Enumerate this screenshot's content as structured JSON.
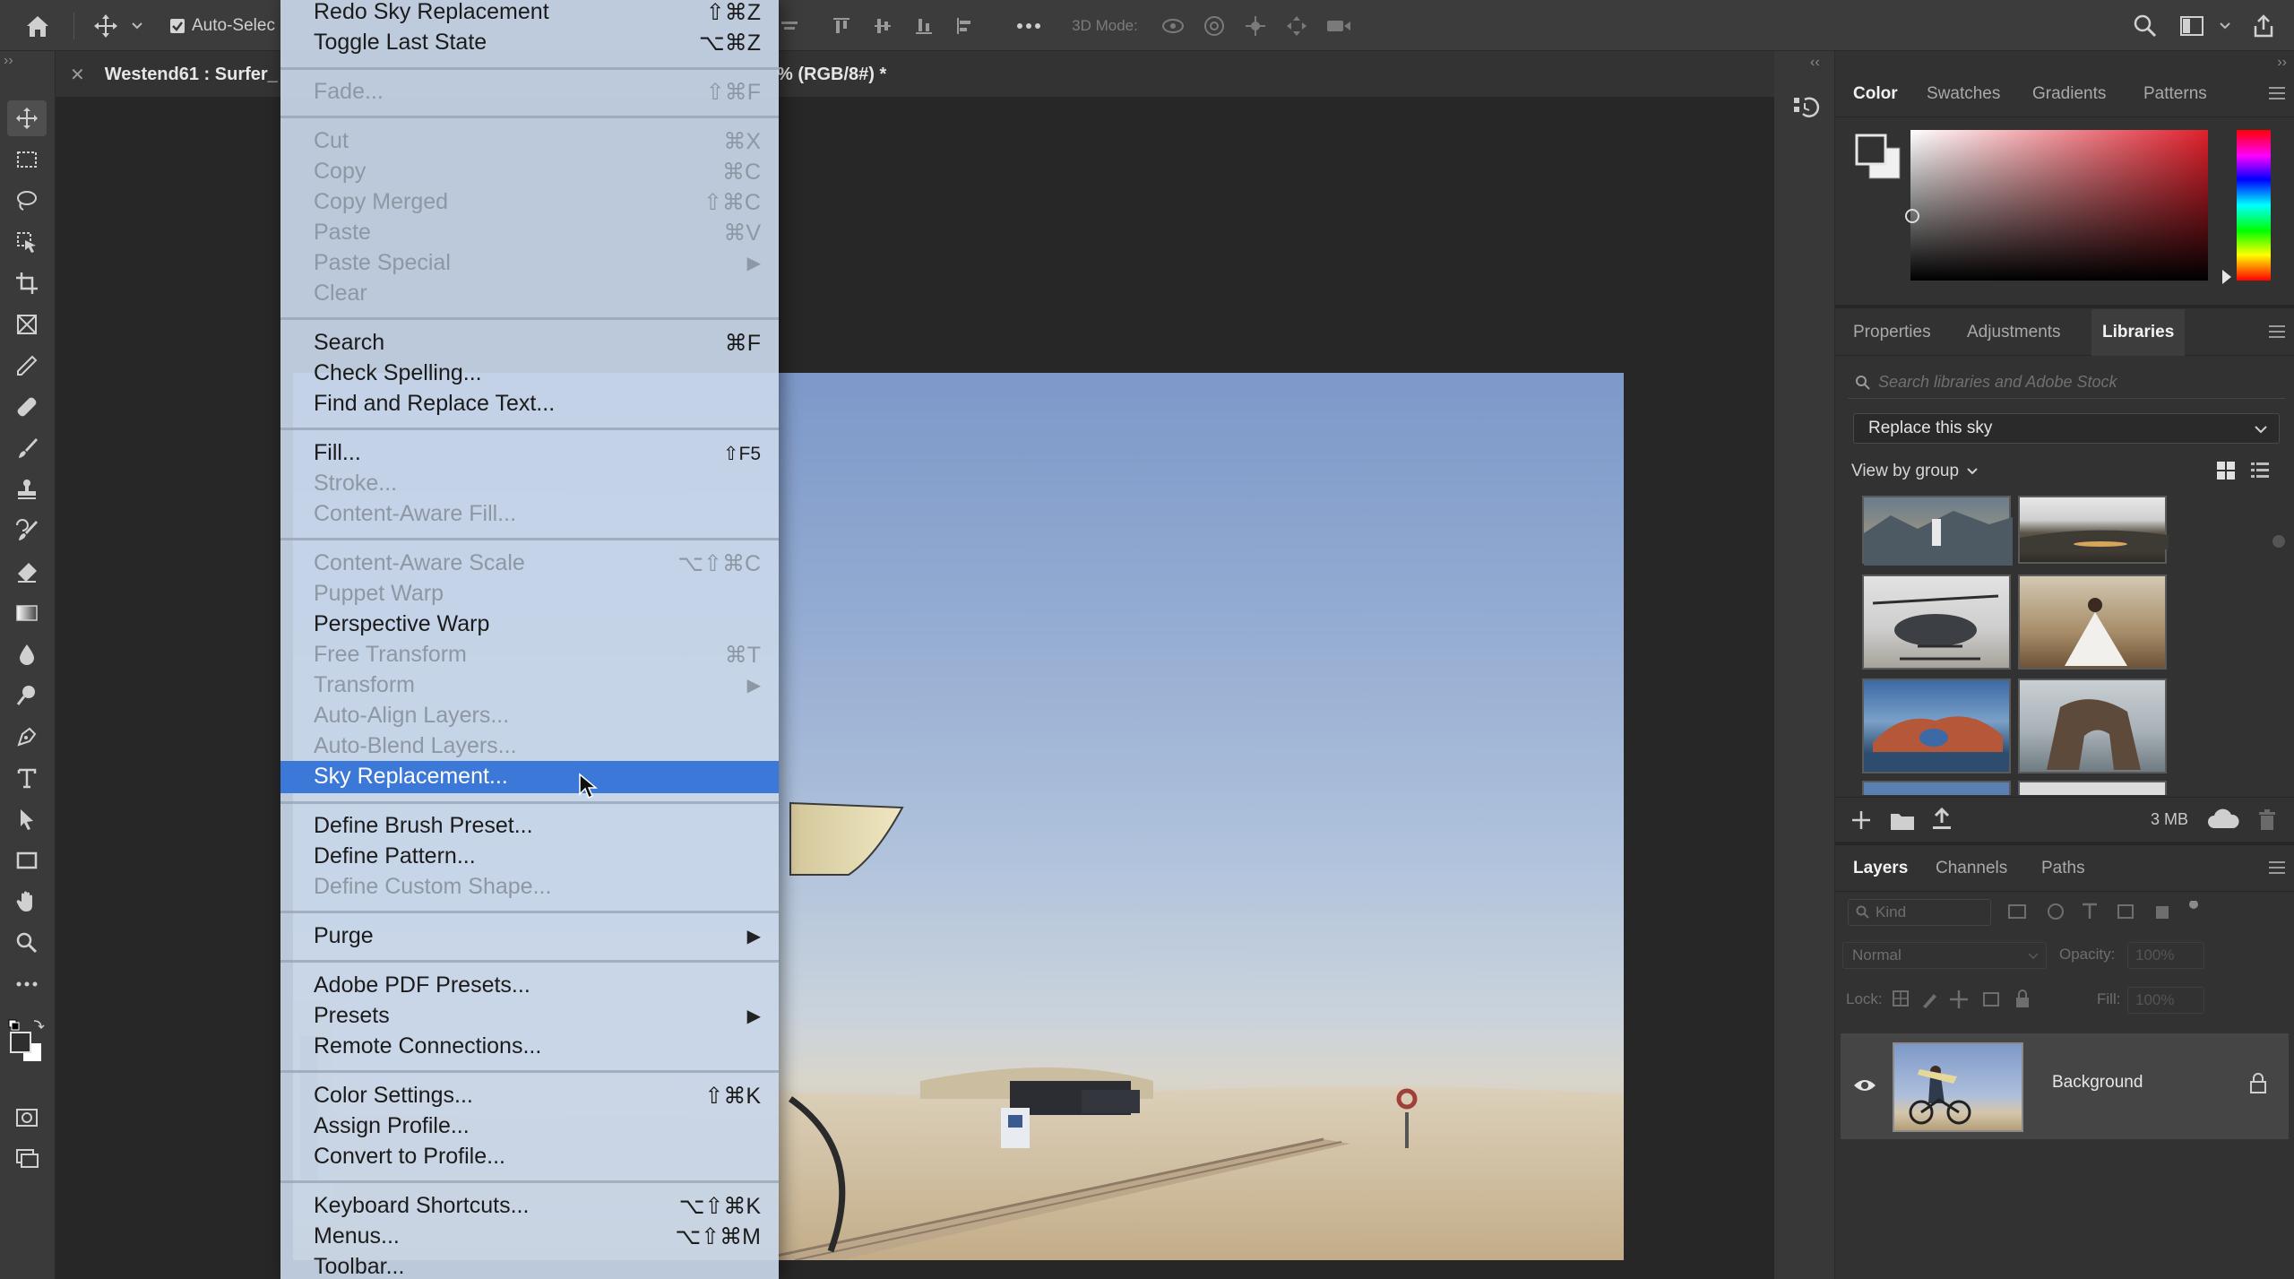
{
  "app": {
    "options_bar": {
      "auto_select_label": "Auto-Selec",
      "mode_3d_label": "3D Mode:"
    },
    "document_tab": {
      "title": "Westend61 : Surfer_",
      "title_suffix": "% (RGB/8#) *"
    },
    "edit_menu": {
      "items": [
        {
          "label": "Redo Sky Replacement",
          "shortcut": "⇧⌘Z",
          "disabled": false
        },
        {
          "label": "Toggle Last State",
          "shortcut": "⌥⌘Z",
          "disabled": false
        },
        {
          "label": "Fade...",
          "shortcut": "⇧⌘F",
          "disabled": true
        },
        {
          "label": "Cut",
          "shortcut": "⌘X",
          "disabled": true
        },
        {
          "label": "Copy",
          "shortcut": "⌘C",
          "disabled": true
        },
        {
          "label": "Copy Merged",
          "shortcut": "⇧⌘C",
          "disabled": true
        },
        {
          "label": "Paste",
          "shortcut": "⌘V",
          "disabled": true
        },
        {
          "label": "Paste Special",
          "shortcut": "",
          "submenu": true,
          "disabled": true
        },
        {
          "label": "Clear",
          "shortcut": "",
          "disabled": true
        },
        {
          "label": "Search",
          "shortcut": "⌘F",
          "disabled": false
        },
        {
          "label": "Check Spelling...",
          "shortcut": "",
          "disabled": false
        },
        {
          "label": "Find and Replace Text...",
          "shortcut": "",
          "disabled": false
        },
        {
          "label": "Fill...",
          "shortcut": "⇧F5",
          "disabled": false
        },
        {
          "label": "Stroke...",
          "shortcut": "",
          "disabled": true
        },
        {
          "label": "Content-Aware Fill...",
          "shortcut": "",
          "disabled": true
        },
        {
          "label": "Content-Aware Scale",
          "shortcut": "⌥⇧⌘C",
          "disabled": true
        },
        {
          "label": "Puppet Warp",
          "shortcut": "",
          "disabled": true
        },
        {
          "label": "Perspective Warp",
          "shortcut": "",
          "disabled": false
        },
        {
          "label": "Free Transform",
          "shortcut": "⌘T",
          "disabled": true
        },
        {
          "label": "Transform",
          "shortcut": "",
          "submenu": true,
          "disabled": true
        },
        {
          "label": "Auto-Align Layers...",
          "shortcut": "",
          "disabled": true
        },
        {
          "label": "Auto-Blend Layers...",
          "shortcut": "",
          "disabled": true
        },
        {
          "label": "Sky Replacement...",
          "shortcut": "",
          "disabled": false,
          "selected": true
        },
        {
          "label": "Define Brush Preset...",
          "shortcut": "",
          "disabled": false
        },
        {
          "label": "Define Pattern...",
          "shortcut": "",
          "disabled": false
        },
        {
          "label": "Define Custom Shape...",
          "shortcut": "",
          "disabled": true
        },
        {
          "label": "Purge",
          "shortcut": "",
          "submenu": true,
          "disabled": false
        },
        {
          "label": "Adobe PDF Presets...",
          "shortcut": "",
          "disabled": false
        },
        {
          "label": "Presets",
          "shortcut": "",
          "submenu": true,
          "disabled": false
        },
        {
          "label": "Remote Connections...",
          "shortcut": "",
          "disabled": false
        },
        {
          "label": "Color Settings...",
          "shortcut": "⇧⌘K",
          "disabled": false
        },
        {
          "label": "Assign Profile...",
          "shortcut": "",
          "disabled": false
        },
        {
          "label": "Convert to Profile...",
          "shortcut": "",
          "disabled": false
        },
        {
          "label": "Keyboard Shortcuts...",
          "shortcut": "⌥⇧⌘K",
          "disabled": false
        },
        {
          "label": "Menus...",
          "shortcut": "⌥⇧⌘M",
          "disabled": false
        },
        {
          "label": "Toolbar...",
          "shortcut": "",
          "disabled": false
        }
      ]
    },
    "color_panel": {
      "tabs": [
        "Color",
        "Swatches",
        "Gradients",
        "Patterns"
      ],
      "active_tab": "Color"
    },
    "libraries_panel": {
      "tabs": [
        "Properties",
        "Adjustments",
        "Libraries"
      ],
      "active_tab": "Libraries",
      "search_placeholder": "Search libraries and Adobe Stock",
      "library_name": "Replace this sky",
      "view_label": "View by group",
      "storage": "3 MB"
    },
    "layers_panel": {
      "tabs": [
        "Layers",
        "Channels",
        "Paths"
      ],
      "active_tab": "Layers",
      "kind_placeholder": "Kind",
      "blend_mode": "Normal",
      "opacity_label": "Opacity:",
      "opacity_value": "100%",
      "lock_label": "Lock:",
      "fill_label": "Fill:",
      "fill_value": "100%",
      "layers": [
        {
          "name": "Background",
          "visible": true,
          "locked": true
        }
      ]
    },
    "colors": {
      "menu_bg": "#c8d6e8",
      "menu_highlight": "#3c78d8",
      "panel_bg": "#323232",
      "toolbar_bg": "#3a3a3a"
    }
  }
}
